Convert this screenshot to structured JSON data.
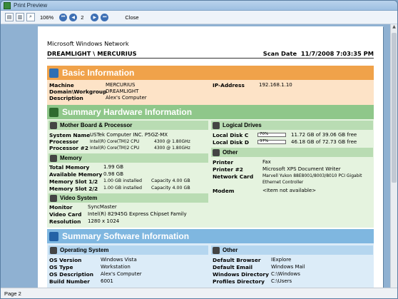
{
  "window": {
    "title": "Print Preview",
    "zoom": "106%",
    "page_field": "2",
    "close_label": "Close",
    "status": "Page 2"
  },
  "report": {
    "network": "Microsoft Windows Network",
    "machine_path": "DREAMLIGHT \\ MERCURIUS",
    "scan_label": "Scan Date",
    "scan_date": "11/7/2008 7:03:35 PM",
    "basic": {
      "title": "Basic Information",
      "machine_label": "Machine",
      "machine": "MERCURIUS",
      "domain_label": "Domain\\Workgroup",
      "domain": "DREAMLIGHT",
      "desc_label": "Description",
      "desc": "Alex's Computer",
      "ip_label": "IP-Address",
      "ip": "192.168.1.10"
    },
    "hardware": {
      "title": "Summary Hardware Information",
      "mb": {
        "title": "Mother Board & Processor",
        "sys_label": "System Name",
        "sys": "USTek Computer INC. P5GZ-MX",
        "p1_label": "Processor",
        "p1": "Intel(R) Core(TM)2 CPU",
        "p1_speed": "4300  @ 1.80GHz",
        "p2_label": "Processor #2",
        "p2": "Intel(R) Core(TM)2 CPU",
        "p2_speed": "4300  @ 1.80GHz"
      },
      "memory": {
        "title": "Memory",
        "total_label": "Total Memory",
        "total": "1.99 GB",
        "avail_label": "Available Memory",
        "avail": "0.98 GB",
        "s12_label": "Memory Slot 1/2",
        "s12": "1.00 GB installed",
        "s12_cap": "Capacity 4.00 GB",
        "s22_label": "Memory Slot 2/2",
        "s22": "1.00 GB installed",
        "s22_cap": "Capacity 4.00 GB"
      },
      "video": {
        "title": "Video System",
        "mon_label": "Monitor",
        "mon": "SyncMaster",
        "card_label": "Video Card",
        "card": "Intel(R) 82945G Express Chipset Family",
        "res_label": "Resolution",
        "res": "1280 x 1024"
      },
      "drives": {
        "title": "Logical Drives",
        "c_label": "Local Disk C",
        "c_pct": "70%",
        "c_fill": 0.7,
        "c_info": "11.72 GB of 39.06 GB free",
        "d_label": "Local Disk D",
        "d_pct": "37%",
        "d_fill": 0.37,
        "d_info": "46.18 GB of 72.73 GB free"
      },
      "other": {
        "title": "Other",
        "printer_label": "Printer",
        "printer": "Fax",
        "printer2_label": "Printer #2",
        "printer2": "Microsoft XPS Document Writer",
        "net_label": "Network Card",
        "net1": "Marvell Yukon 88E8001/8003/8010 PCI Gigabit",
        "net2": "Ethernet Controller",
        "modem_label": "Modem",
        "modem": "<Item not available>"
      }
    },
    "software": {
      "title": "Summary Software Information",
      "os": {
        "title": "Operating System",
        "ver_label": "OS Version",
        "ver": "Windows Vista",
        "type_label": "OS Type",
        "type": "Workstation",
        "desc_label": "OS Description",
        "desc": "Alex's Computer",
        "build_label": "Build Number",
        "build": "6001"
      },
      "other": {
        "title": "Other",
        "browser_label": "Default Browser",
        "browser": "IExplore",
        "email_label": "Default Email",
        "email": "Windows Mail",
        "windir_label": "Windows Directory",
        "windir": "C:\\Windows",
        "prof_label": "Profiles Directory",
        "prof": "C:\\Users"
      }
    }
  },
  "colors": {
    "orange": "#f0a24a",
    "green": "#8fc78a",
    "blue": "#7fb7e0",
    "basic_bg": "#fde3c7",
    "hw_bg": "#e5f3df",
    "sw_bg": "#dcecf8"
  }
}
